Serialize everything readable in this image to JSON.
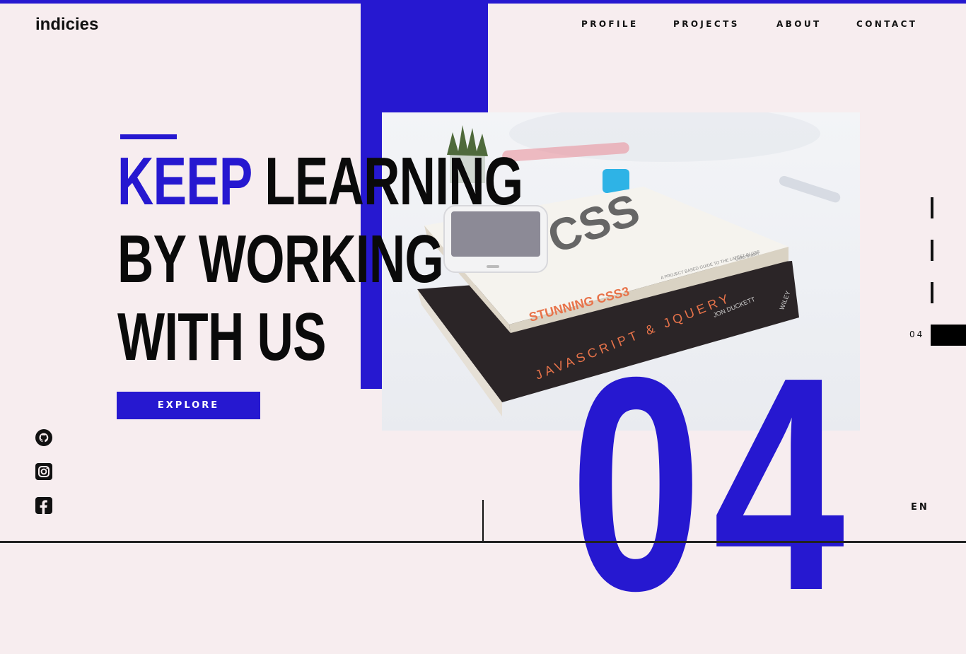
{
  "brand": {
    "logo": "indicies",
    "accent_color": "#2618d0",
    "background_color": "#f7edef"
  },
  "nav": {
    "items": [
      {
        "label": "PROFILE"
      },
      {
        "label": "PROJECTS"
      },
      {
        "label": "ABOUT"
      },
      {
        "label": "CONTACT"
      }
    ]
  },
  "hero": {
    "headline_accent": "KEEP",
    "headline_line1_rest": "LEARNING",
    "headline_line2": "BY WORKING",
    "headline_line3": "WITH US",
    "cta_label": "EXPLORE",
    "big_number": "04",
    "photo": {
      "book_top_title": "STUNNING CSS3",
      "book_top_subtitle": "A PROJECT BASED GUIDE TO THE LATEST IN CSS",
      "book_top_author": "Gillenwater",
      "book_bottom_title": "JAVASCRIPT & JQUERY",
      "book_bottom_author": "JON DUCKETT",
      "book_bottom_publisher": "WILEY"
    }
  },
  "social": [
    {
      "icon": "github-icon"
    },
    {
      "icon": "instagram-icon"
    },
    {
      "icon": "facebook-icon"
    }
  ],
  "pager": {
    "current": "04",
    "total_slides": 4,
    "current_index": 4
  },
  "lang": "EN"
}
